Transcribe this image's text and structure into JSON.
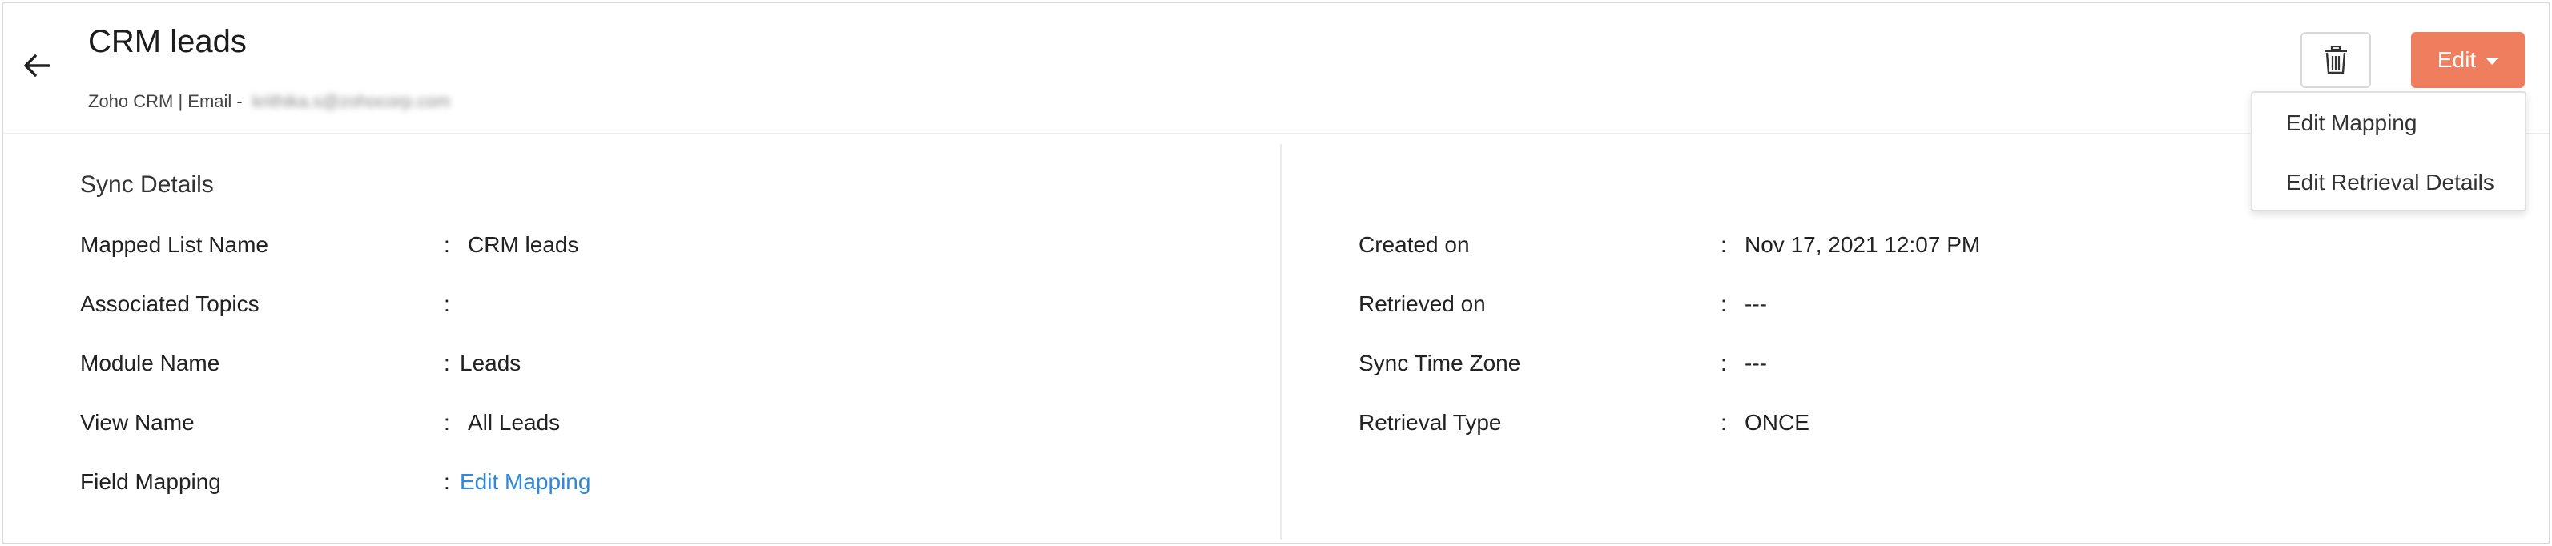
{
  "header": {
    "title": "CRM leads",
    "subtitle_prefix": "Zoho CRM | Email - ",
    "email": "krithika.s@zohocorp.com",
    "edit_label": "Edit"
  },
  "dropdown": {
    "items": [
      {
        "label": "Edit Mapping"
      },
      {
        "label": "Edit Retrieval Details"
      }
    ]
  },
  "sync_details": {
    "title": "Sync Details",
    "left": [
      {
        "label": "Mapped List Name",
        "value": "CRM leads"
      },
      {
        "label": "Associated Topics",
        "value": ""
      },
      {
        "label": "Module Name",
        "value": "Leads"
      },
      {
        "label": "View Name",
        "value": "All Leads"
      },
      {
        "label": "Field Mapping",
        "value": "Edit Mapping"
      }
    ],
    "right": [
      {
        "label": "Created on",
        "value": "Nov 17, 2021 12:07 PM"
      },
      {
        "label": "Retrieved on",
        "value": "---"
      },
      {
        "label": "Sync Time Zone",
        "value": "---"
      },
      {
        "label": "Retrieval Type",
        "value": "ONCE"
      }
    ],
    "separator": ":"
  },
  "colors": {
    "accent": "#ef7e5f",
    "link": "#2f88d8"
  },
  "icons": {
    "back": "arrow-left-icon",
    "delete": "trash-icon",
    "dropdown": "caret-down-icon"
  }
}
